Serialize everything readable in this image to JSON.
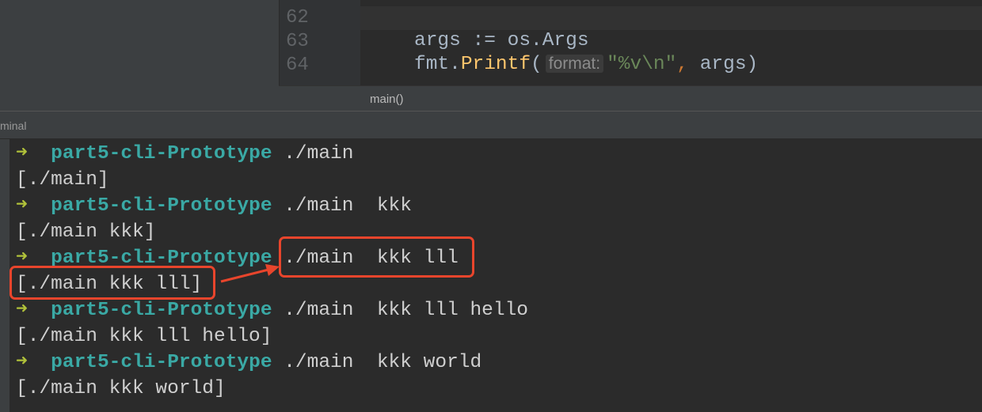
{
  "editor": {
    "line_numbers": [
      "62",
      "63",
      "64"
    ],
    "code_line_63": "args := os.Args",
    "code_64": {
      "obj": "fmt.",
      "fn": "Printf",
      "open": "(",
      "hint": "format:",
      "str": "\"%v\\n\"",
      "comma": ",",
      "rest": " args)"
    },
    "breadcrumb": "main()"
  },
  "tool_window": {
    "title": "minal"
  },
  "terminal": {
    "prompt_arrow": "➜",
    "prompt_dir": "part5-cli-Prototype",
    "lines": [
      {
        "cmd": "./main",
        "out": "[./main]"
      },
      {
        "cmd": "./main  kkk",
        "out": "[./main kkk]"
      },
      {
        "cmd": "./main  kkk lll",
        "out": "[./main kkk lll]"
      },
      {
        "cmd": "./main  kkk lll hello",
        "out": "[./main kkk lll hello]"
      },
      {
        "cmd": "./main  kkk world",
        "out": "[./main kkk world]"
      }
    ]
  },
  "annotation_color": "#e8452c"
}
